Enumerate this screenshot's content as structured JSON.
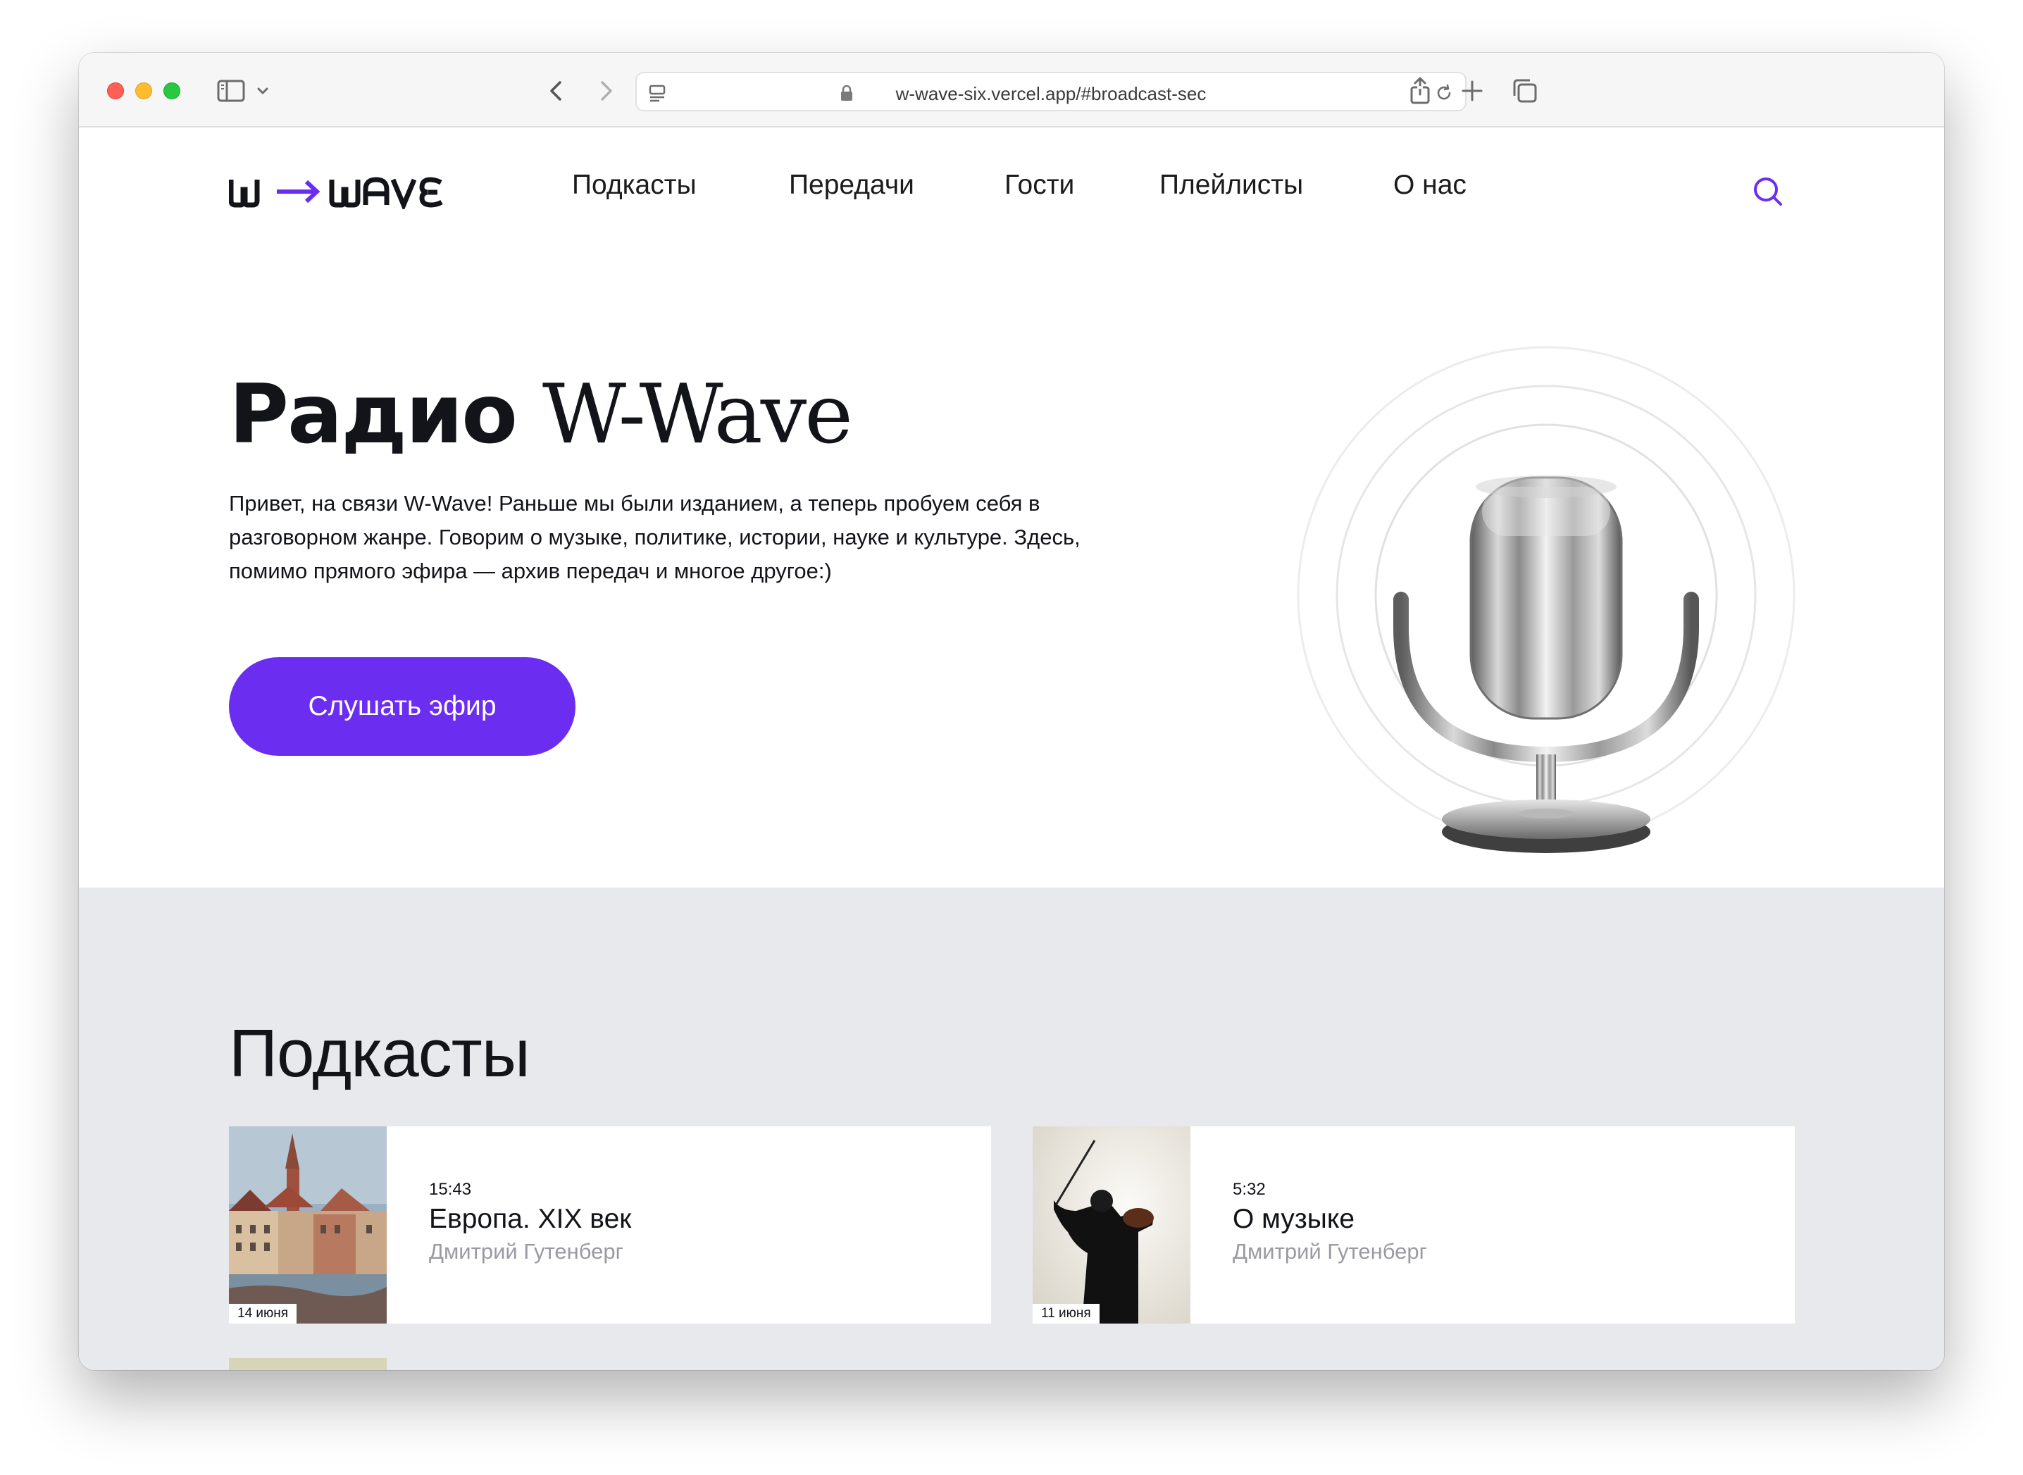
{
  "browser": {
    "url": "w-wave-six.vercel.app/#broadcast-sec"
  },
  "header": {
    "logo_text": "W→WAVE",
    "nav": [
      "Подкасты",
      "Передачи",
      "Гости",
      "Плейлисты",
      "О нас"
    ]
  },
  "hero": {
    "title_part1": "Радио",
    "title_part2": "W-Wave",
    "description": "Привет, на связи W-Wave! Раньше мы были изданием, а теперь пробуем себя в разговорном жанре. Говорим о музыке, политике, истории, науке и культуре. Здесь, помимо прямого эфира — архив передач и многое другое:)",
    "cta_label": "Слушать эфир"
  },
  "podcasts": {
    "title": "Подкасты",
    "items": [
      {
        "time": "15:43",
        "name": "Европа. XIX век",
        "author": "Дмитрий Гутенберг",
        "date": "14 июня"
      },
      {
        "time": "5:32",
        "name": "О музыке",
        "author": "Дмитрий Гутенберг",
        "date": "11 июня"
      }
    ]
  },
  "colors": {
    "accent": "#6b2ef0",
    "gray_section": "#e8e9ed",
    "text": "#121419",
    "muted": "#9a9aa4"
  }
}
